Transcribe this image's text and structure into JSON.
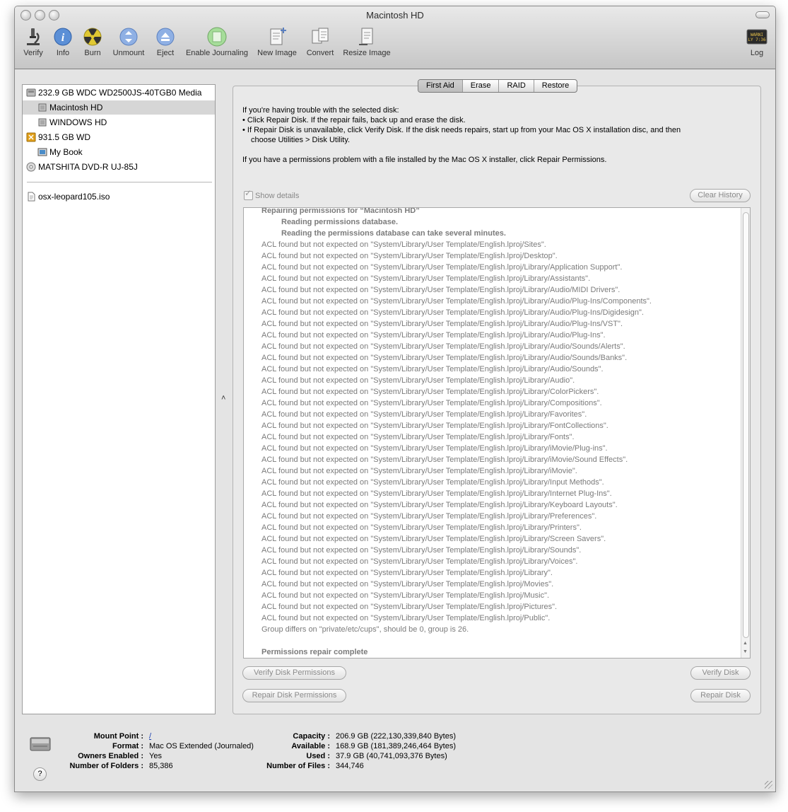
{
  "window": {
    "title": "Macintosh HD"
  },
  "toolbar": {
    "verify": "Verify",
    "info": "Info",
    "burn": "Burn",
    "unmount": "Unmount",
    "eject": "Eject",
    "journaling": "Enable Journaling",
    "new_image": "New Image",
    "convert": "Convert",
    "resize_image": "Resize Image",
    "log": "Log",
    "log_icon_text": "WARNI\nLY 7:36"
  },
  "sidebar": {
    "items": [
      {
        "label": "232.9 GB WDC WD2500JS-40TGB0 Media"
      },
      {
        "label": "Macintosh HD"
      },
      {
        "label": "WINDOWS HD"
      },
      {
        "label": "931.5 GB WD"
      },
      {
        "label": "My Book"
      },
      {
        "label": "MATSHITA DVD-R UJ-85J"
      },
      {
        "label": "osx-leopard105.iso"
      }
    ]
  },
  "tabs": {
    "first_aid": "First Aid",
    "erase": "Erase",
    "raid": "RAID",
    "restore": "Restore"
  },
  "help": {
    "line1": "If you're having trouble with the selected disk:",
    "line2": "• Click Repair Disk. If the repair fails, back up and erase the disk.",
    "line3": "• If Repair Disk is unavailable, click Verify Disk. If the disk needs repairs, start up from your Mac OS X installation disc, and then",
    "line4": "choose Utilities > Disk Utility.",
    "line5": "If you have a permissions problem with a file installed by the Mac OS X installer, click Repair Permissions."
  },
  "show_details": "Show details",
  "buttons": {
    "clear_history": "Clear History",
    "verify_permissions": "Verify Disk Permissions",
    "repair_permissions": "Repair Disk Permissions",
    "verify_disk": "Verify Disk",
    "repair_disk": "Repair Disk"
  },
  "log": {
    "header": "Repairing permissions for “Macintosh HD”",
    "sub1": "Reading permissions database.",
    "sub2": "Reading the permissions database can take several minutes.",
    "acl_lines": [
      "ACL found but not expected on \"System/Library/User Template/English.lproj/Sites\".",
      "ACL found but not expected on \"System/Library/User Template/English.lproj/Desktop\".",
      "ACL found but not expected on \"System/Library/User Template/English.lproj/Library/Application Support\".",
      "ACL found but not expected on \"System/Library/User Template/English.lproj/Library/Assistants\".",
      "ACL found but not expected on \"System/Library/User Template/English.lproj/Library/Audio/MIDI Drivers\".",
      "ACL found but not expected on \"System/Library/User Template/English.lproj/Library/Audio/Plug-Ins/Components\".",
      "ACL found but not expected on \"System/Library/User Template/English.lproj/Library/Audio/Plug-Ins/Digidesign\".",
      "ACL found but not expected on \"System/Library/User Template/English.lproj/Library/Audio/Plug-Ins/VST\".",
      "ACL found but not expected on \"System/Library/User Template/English.lproj/Library/Audio/Plug-Ins\".",
      "ACL found but not expected on \"System/Library/User Template/English.lproj/Library/Audio/Sounds/Alerts\".",
      "ACL found but not expected on \"System/Library/User Template/English.lproj/Library/Audio/Sounds/Banks\".",
      "ACL found but not expected on \"System/Library/User Template/English.lproj/Library/Audio/Sounds\".",
      "ACL found but not expected on \"System/Library/User Template/English.lproj/Library/Audio\".",
      "ACL found but not expected on \"System/Library/User Template/English.lproj/Library/ColorPickers\".",
      "ACL found but not expected on \"System/Library/User Template/English.lproj/Library/Compositions\".",
      "ACL found but not expected on \"System/Library/User Template/English.lproj/Library/Favorites\".",
      "ACL found but not expected on \"System/Library/User Template/English.lproj/Library/FontCollections\".",
      "ACL found but not expected on \"System/Library/User Template/English.lproj/Library/Fonts\".",
      "ACL found but not expected on \"System/Library/User Template/English.lproj/Library/iMovie/Plug-ins\".",
      "ACL found but not expected on \"System/Library/User Template/English.lproj/Library/iMovie/Sound Effects\".",
      "ACL found but not expected on \"System/Library/User Template/English.lproj/Library/iMovie\".",
      "ACL found but not expected on \"System/Library/User Template/English.lproj/Library/Input Methods\".",
      "ACL found but not expected on \"System/Library/User Template/English.lproj/Library/Internet Plug-Ins\".",
      "ACL found but not expected on \"System/Library/User Template/English.lproj/Library/Keyboard Layouts\".",
      "ACL found but not expected on \"System/Library/User Template/English.lproj/Library/Preferences\".",
      "ACL found but not expected on \"System/Library/User Template/English.lproj/Library/Printers\".",
      "ACL found but not expected on \"System/Library/User Template/English.lproj/Library/Screen Savers\".",
      "ACL found but not expected on \"System/Library/User Template/English.lproj/Library/Sounds\".",
      "ACL found but not expected on \"System/Library/User Template/English.lproj/Library/Voices\".",
      "ACL found but not expected on \"System/Library/User Template/English.lproj/Library\".",
      "ACL found but not expected on \"System/Library/User Template/English.lproj/Movies\".",
      "ACL found but not expected on \"System/Library/User Template/English.lproj/Music\".",
      "ACL found but not expected on \"System/Library/User Template/English.lproj/Pictures\".",
      "ACL found but not expected on \"System/Library/User Template/English.lproj/Public\"."
    ],
    "group_line": "Group differs on \"private/etc/cups\", should be 0, group is 26.",
    "complete": "Permissions repair complete"
  },
  "info": {
    "mount_point_label": "Mount Point :",
    "mount_point_value": "/",
    "format_label": "Format :",
    "format_value": "Mac OS Extended (Journaled)",
    "owners_label": "Owners Enabled :",
    "owners_value": "Yes",
    "folders_label": "Number of Folders :",
    "folders_value": "85,386",
    "capacity_label": "Capacity :",
    "capacity_value": "206.9 GB (222,130,339,840 Bytes)",
    "available_label": "Available :",
    "available_value": "168.9 GB (181,389,246,464 Bytes)",
    "used_label": "Used :",
    "used_value": "37.9 GB (40,741,093,376 Bytes)",
    "files_label": "Number of Files :",
    "files_value": "344,746",
    "help_glyph": "?"
  }
}
